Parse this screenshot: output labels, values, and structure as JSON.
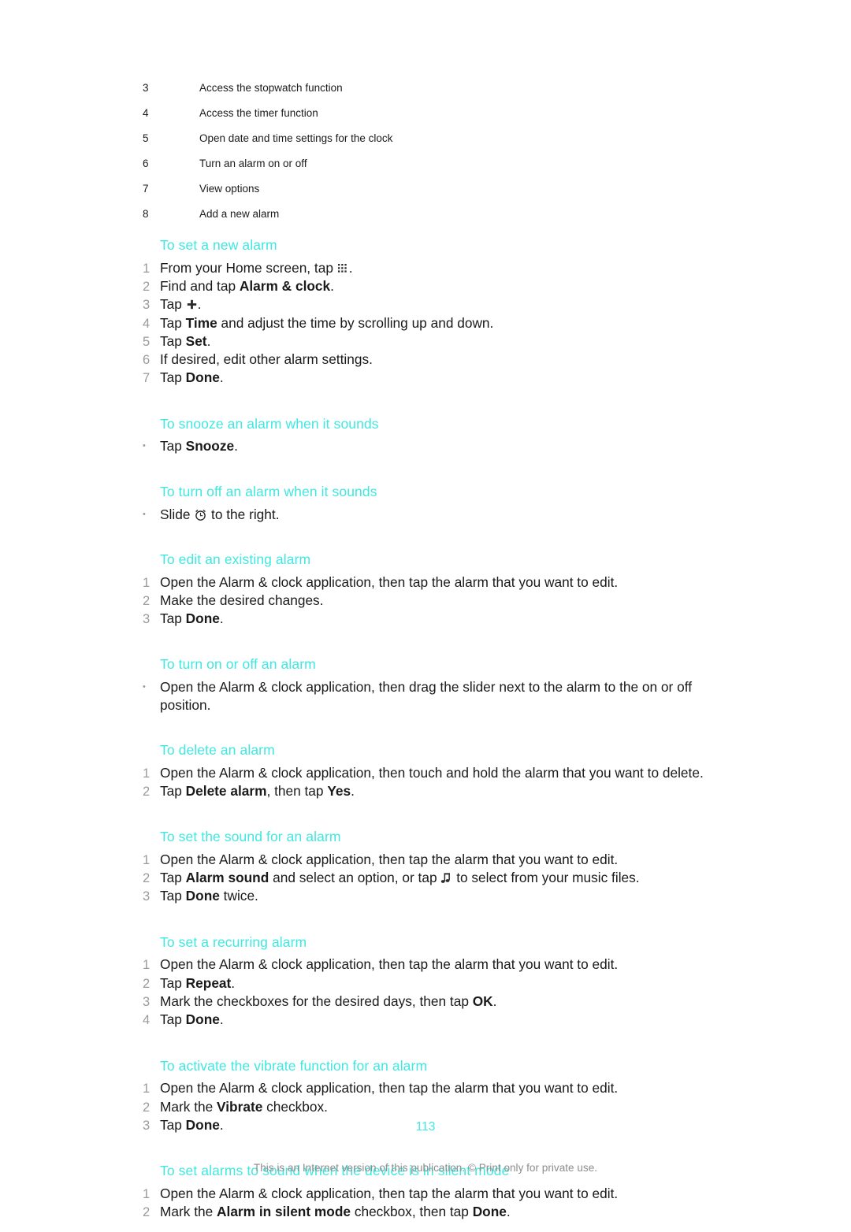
{
  "document": {
    "page_number": "113",
    "footer_note": "This is an Internet version of this publication. © Print only for private use.",
    "heading_color": "#3fe8e0",
    "step_number_color": "#9b9b9b",
    "body_text_color": "#1a1a1a",
    "footer_note_color": "#8d8d8d"
  },
  "legend": {
    "items": [
      {
        "number": "3",
        "text": "Access the stopwatch function"
      },
      {
        "number": "4",
        "text": "Access the timer function"
      },
      {
        "number": "5",
        "text": "Open date and time settings for the clock"
      },
      {
        "number": "6",
        "text": "Turn an alarm on or off"
      },
      {
        "number": "7",
        "text": "View options"
      },
      {
        "number": "8",
        "text": "Add a new alarm"
      }
    ]
  },
  "sections": [
    {
      "heading": "To set a new alarm",
      "steps": [
        {
          "marker": "1",
          "text_before": "From your Home screen, tap ",
          "icon": "app-grid-icon",
          "text_after": "."
        },
        {
          "marker": "2",
          "text_before": "Find and tap ",
          "bold": "Alarm & clock",
          "text_after": "."
        },
        {
          "marker": "3",
          "text_before": "Tap ",
          "icon": "plus-icon",
          "text_after": "."
        },
        {
          "marker": "4",
          "text_before": "Tap ",
          "bold": "Time",
          "text_after": " and adjust the time by scrolling up and down."
        },
        {
          "marker": "5",
          "text_before": "Tap ",
          "bold": "Set",
          "text_after": "."
        },
        {
          "marker": "6",
          "text_before": "If desired, edit other alarm settings.",
          "text_after": ""
        },
        {
          "marker": "7",
          "text_before": "Tap ",
          "bold": "Done",
          "text_after": "."
        }
      ]
    },
    {
      "heading": "To snooze an alarm when it sounds",
      "steps": [
        {
          "marker": "•",
          "text_before": "Tap ",
          "bold": "Snooze",
          "text_after": "."
        }
      ]
    },
    {
      "heading": "To turn off an alarm when it sounds",
      "steps": [
        {
          "marker": "•",
          "text_before": "Slide ",
          "icon": "alarm-clock-icon",
          "text_after": " to the right."
        }
      ]
    },
    {
      "heading": "To edit an existing alarm",
      "steps": [
        {
          "marker": "1",
          "text_before": "Open the Alarm & clock application, then tap the alarm that you want to edit.",
          "text_after": ""
        },
        {
          "marker": "2",
          "text_before": "Make the desired changes.",
          "text_after": ""
        },
        {
          "marker": "3",
          "text_before": "Tap ",
          "bold": "Done",
          "text_after": "."
        }
      ]
    },
    {
      "heading": "To turn on or off an alarm",
      "steps": [
        {
          "marker": "•",
          "text_before": "Open the Alarm & clock application, then drag the slider next to the alarm to the on or off position.",
          "text_after": ""
        }
      ]
    },
    {
      "heading": "To delete an alarm",
      "steps": [
        {
          "marker": "1",
          "text_before": "Open the Alarm & clock application, then touch and hold the alarm that you want to delete.",
          "text_after": ""
        },
        {
          "marker": "2",
          "text_before": "Tap ",
          "bold": "Delete alarm",
          "text_mid": ", then tap ",
          "bold2": "Yes",
          "text_after": "."
        }
      ]
    },
    {
      "heading": "To set the sound for an alarm",
      "steps": [
        {
          "marker": "1",
          "text_before": "Open the Alarm & clock application, then tap the alarm that you want to edit.",
          "text_after": ""
        },
        {
          "marker": "2",
          "text_before": "Tap ",
          "bold": "Alarm sound",
          "text_mid": " and select an option, or tap ",
          "icon": "music-note-icon",
          "text_after": " to select from your music files."
        },
        {
          "marker": "3",
          "text_before": "Tap ",
          "bold": "Done",
          "text_after": " twice."
        }
      ]
    },
    {
      "heading": "To set a recurring alarm",
      "steps": [
        {
          "marker": "1",
          "text_before": "Open the Alarm & clock application, then tap the alarm that you want to edit.",
          "text_after": ""
        },
        {
          "marker": "2",
          "text_before": "Tap ",
          "bold": "Repeat",
          "text_after": "."
        },
        {
          "marker": "3",
          "text_before": "Mark the checkboxes for the desired days, then tap ",
          "bold": "OK",
          "text_after": "."
        },
        {
          "marker": "4",
          "text_before": "Tap ",
          "bold": "Done",
          "text_after": "."
        }
      ]
    },
    {
      "heading": "To activate the vibrate function for an alarm",
      "steps": [
        {
          "marker": "1",
          "text_before": "Open the Alarm & clock application, then tap the alarm that you want to edit.",
          "text_after": ""
        },
        {
          "marker": "2",
          "text_before": "Mark the ",
          "bold": "Vibrate",
          "text_after": " checkbox."
        },
        {
          "marker": "3",
          "text_before": "Tap ",
          "bold": "Done",
          "text_after": "."
        }
      ]
    },
    {
      "heading": "To set alarms to sound when the device is in silent mode",
      "steps": [
        {
          "marker": "1",
          "text_before": "Open the Alarm & clock application, then tap the alarm that you want to edit.",
          "text_after": ""
        },
        {
          "marker": "2",
          "text_before": "Mark the ",
          "bold": "Alarm in silent mode",
          "text_mid": " checkbox, then tap ",
          "bold2": "Done",
          "text_after": "."
        }
      ]
    }
  ]
}
